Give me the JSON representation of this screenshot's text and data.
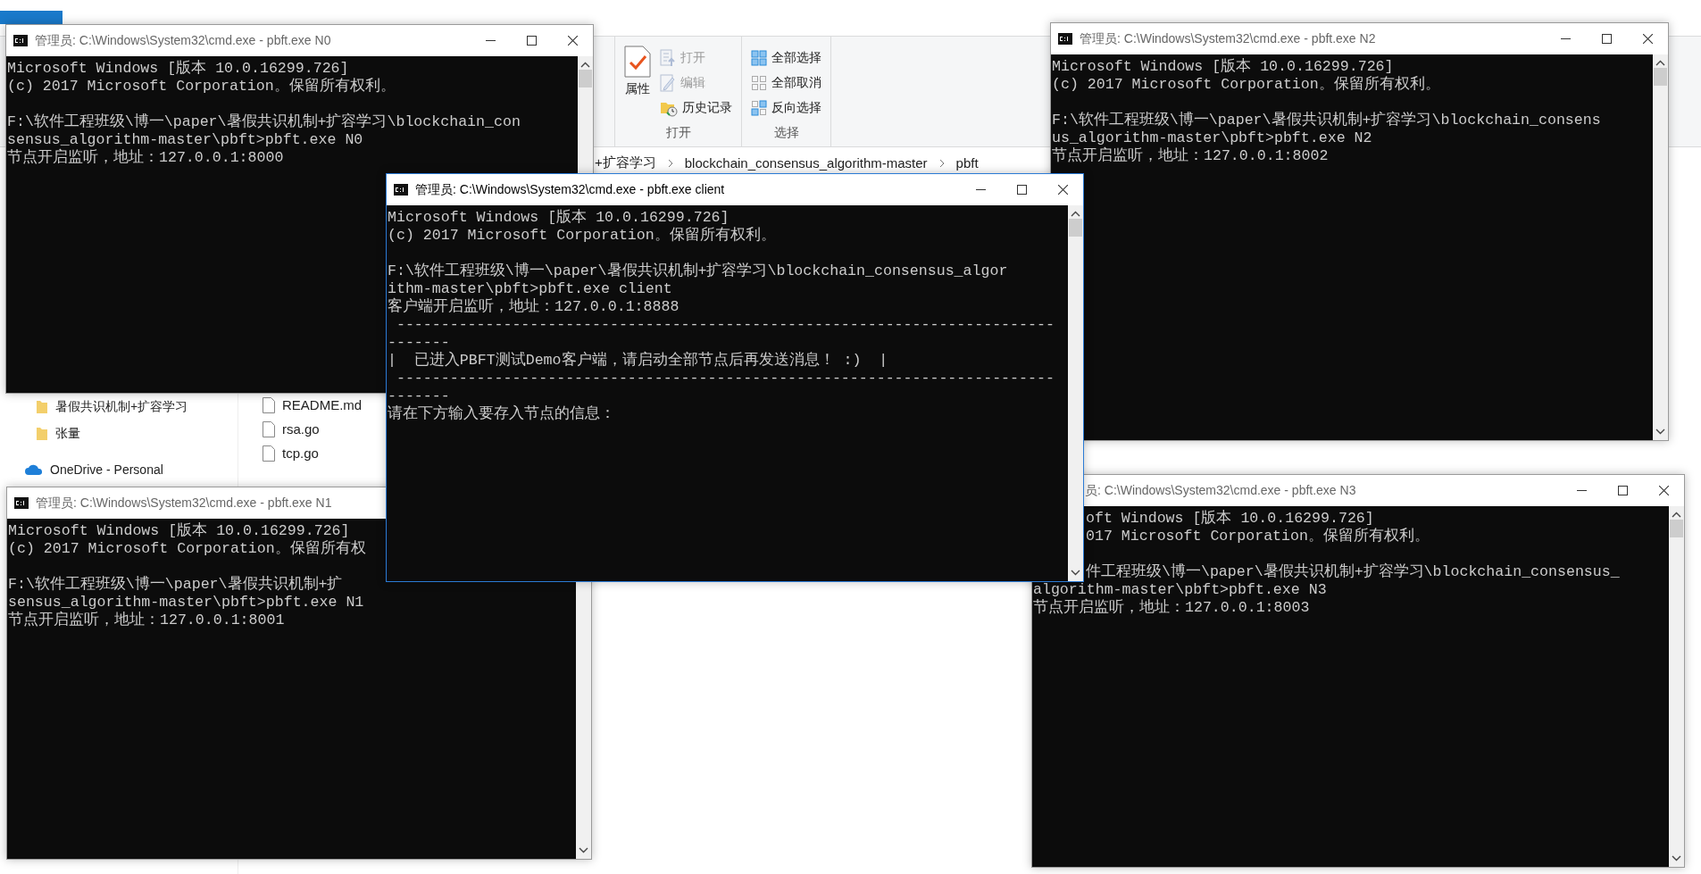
{
  "explorer": {
    "ribbon_groups": [
      {
        "label": "打开",
        "items": [
          {
            "label": "属性",
            "kind": "large",
            "disabled": false
          },
          {
            "label": "打开",
            "kind": "small",
            "disabled": true
          },
          {
            "label": "编辑",
            "kind": "small",
            "disabled": true
          },
          {
            "label": "历史记录",
            "kind": "small",
            "disabled": false
          }
        ]
      },
      {
        "label": "选择",
        "items": [
          {
            "label": "全部选择",
            "kind": "small",
            "disabled": false
          },
          {
            "label": "全部取消",
            "kind": "small",
            "disabled": false
          },
          {
            "label": "反向选择",
            "kind": "small",
            "disabled": false
          }
        ]
      }
    ],
    "breadcrumb": [
      "+扩容学习",
      "blockchain_consensus_algorithm-master",
      "pbft"
    ],
    "nav_items": [
      {
        "label": "暑假共识机制+扩容学习",
        "kind": "folder"
      },
      {
        "label": "张量",
        "kind": "folder"
      },
      {
        "label": "OneDrive - Personal",
        "kind": "cloud"
      }
    ],
    "files": [
      {
        "name": "README.md"
      },
      {
        "name": "rsa.go"
      },
      {
        "name": "tcp.go"
      }
    ]
  },
  "windows": [
    {
      "title": "管理员: C:\\Windows\\System32\\cmd.exe - pbft.exe  N0",
      "active": false,
      "blocks": [
        [
          "Microsoft Windows [版本 10.0.16299.726]",
          "(c) 2017 Microsoft Corporation。保留所有权利。"
        ],
        [
          "F:\\软件工程班级\\博一\\paper\\暑假共识机制+扩容学习\\blockchain_con",
          "sensus_algorithm-master\\pbft>pbft.exe N0",
          "节点开启监听，地址：127.0.0.1:8000"
        ]
      ]
    },
    {
      "title": "管理员: C:\\Windows\\System32\\cmd.exe - pbft.exe  N2",
      "active": false,
      "blocks": [
        [
          "Microsoft Windows [版本 10.0.16299.726]",
          "(c) 2017 Microsoft Corporation。保留所有权利。"
        ],
        [
          "F:\\软件工程班级\\博一\\paper\\暑假共识机制+扩容学习\\blockchain_consens",
          "us_algorithm-master\\pbft>pbft.exe N2",
          "节点开启监听，地址：127.0.0.1:8002"
        ]
      ]
    },
    {
      "title": "管理员: C:\\Windows\\System32\\cmd.exe - pbft.exe  client",
      "active": true,
      "blocks": [
        [
          "Microsoft Windows [版本 10.0.16299.726]",
          "(c) 2017 Microsoft Corporation。保留所有权利。"
        ],
        [
          "F:\\软件工程班级\\博一\\paper\\暑假共识机制+扩容学习\\blockchain_consensus_algor",
          "ithm-master\\pbft>pbft.exe client",
          "客户端开启监听，地址：127.0.0.1:8888",
          " --------------------------------------------------------------------------",
          "-------",
          "|  已进入PBFT测试Demo客户端，请启动全部节点后再发送消息！ :)  |",
          " --------------------------------------------------------------------------",
          "-------",
          "请在下方输入要存入节点的信息："
        ]
      ]
    },
    {
      "title": "管理员: C:\\Windows\\System32\\cmd.exe - pbft.exe  N1",
      "active": false,
      "blocks": [
        [
          "Microsoft Windows [版本 10.0.16299.726]",
          "(c) 2017 Microsoft Corporation。保留所有权"
        ],
        [
          "F:\\软件工程班级\\博一\\paper\\暑假共识机制+扩",
          "sensus_algorithm-master\\pbft>pbft.exe N1",
          "节点开启监听，地址：127.0.0.1:8001"
        ]
      ]
    },
    {
      "title": "员: C:\\Windows\\System32\\cmd.exe - pbft.exe  N3",
      "active": false,
      "blocks": [
        [
          "oft Windows [版本 10.0.16299.726]",
          "017 Microsoft Corporation。保留所有权利。"
        ],
        [
          "件工程班级\\博一\\paper\\暑假共识机制+扩容学习\\blockchain_consensus_",
          "algorithm-master\\pbft>pbft.exe N3",
          "节点开启监听，地址：127.0.0.1:8003"
        ]
      ]
    }
  ]
}
